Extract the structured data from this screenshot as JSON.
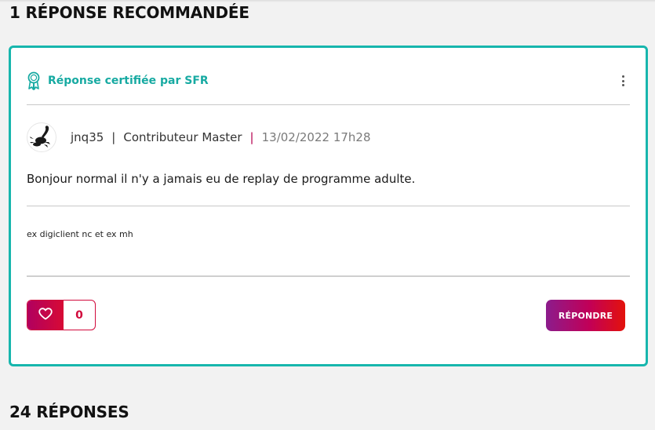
{
  "sections": {
    "recommended_title": "1 RÉPONSE RECOMMANDÉE",
    "replies_title": "24 RÉPONSES"
  },
  "card": {
    "certified_label": "Réponse certifiée par SFR",
    "author": {
      "username": "jnq35",
      "rank": "Contributeur Master",
      "date": "13/02/2022 17h28",
      "separator": "|"
    },
    "message": "Bonjour normal il n'y a jamais eu de replay de programme adulte.",
    "signature": "ex digiclient nc et ex mh",
    "like_count": "0",
    "reply_label": "RÉPONDRE"
  },
  "colors": {
    "accent_teal": "#17b6ad",
    "brand_red": "#d10a3c",
    "brand_purple": "#8c1c8c"
  },
  "icons": {
    "certified": "award-ribbon-icon",
    "menu": "vertical-dots-icon",
    "like": "heart-icon"
  }
}
